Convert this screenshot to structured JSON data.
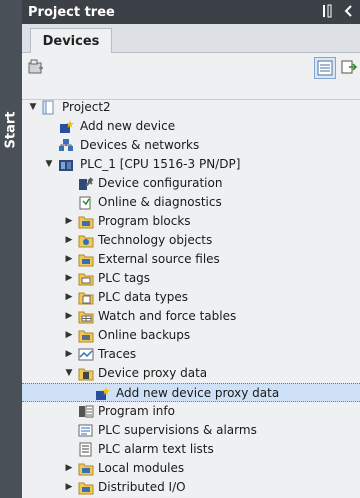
{
  "sidebar": {
    "start_label": "Start"
  },
  "panel": {
    "title": "Project tree",
    "tab": "Devices"
  },
  "tree": [
    {
      "label": "Project2",
      "level": 0,
      "arrow": "down",
      "icon": "project-icon"
    },
    {
      "label": "Add new device",
      "level": 1,
      "arrow": "none",
      "icon": "add-device-icon"
    },
    {
      "label": "Devices & networks",
      "level": 1,
      "arrow": "none",
      "icon": "network-icon"
    },
    {
      "label": "PLC_1 [CPU 1516-3 PN/DP]",
      "level": 1,
      "arrow": "down",
      "icon": "plc-icon"
    },
    {
      "label": "Device configuration",
      "level": 2,
      "arrow": "none",
      "icon": "device-config-icon"
    },
    {
      "label": "Online & diagnostics",
      "level": 2,
      "arrow": "none",
      "icon": "diagnostics-icon"
    },
    {
      "label": "Program blocks",
      "level": 2,
      "arrow": "right",
      "icon": "folder-icon"
    },
    {
      "label": "Technology objects",
      "level": 2,
      "arrow": "right",
      "icon": "technology-icon"
    },
    {
      "label": "External source files",
      "level": 2,
      "arrow": "right",
      "icon": "folder-icon"
    },
    {
      "label": "PLC tags",
      "level": 2,
      "arrow": "right",
      "icon": "tags-icon"
    },
    {
      "label": "PLC data types",
      "level": 2,
      "arrow": "right",
      "icon": "datatypes-icon"
    },
    {
      "label": "Watch and force tables",
      "level": 2,
      "arrow": "right",
      "icon": "watch-table-icon"
    },
    {
      "label": "Online backups",
      "level": 2,
      "arrow": "right",
      "icon": "backup-icon"
    },
    {
      "label": "Traces",
      "level": 2,
      "arrow": "right",
      "icon": "traces-icon"
    },
    {
      "label": "Device proxy data",
      "level": 2,
      "arrow": "down",
      "icon": "proxy-folder-icon"
    },
    {
      "label": "Add new device proxy data",
      "level": 3,
      "arrow": "none",
      "icon": "add-proxy-icon",
      "selected": true
    },
    {
      "label": "Program info",
      "level": 2,
      "arrow": "none",
      "icon": "program-info-icon"
    },
    {
      "label": "PLC supervisions & alarms",
      "level": 2,
      "arrow": "none",
      "icon": "alarms-icon"
    },
    {
      "label": "PLC alarm text lists",
      "level": 2,
      "arrow": "none",
      "icon": "text-list-icon"
    },
    {
      "label": "Local modules",
      "level": 2,
      "arrow": "right",
      "icon": "folder-icon"
    },
    {
      "label": "Distributed I/O",
      "level": 2,
      "arrow": "right",
      "icon": "folder-icon"
    }
  ]
}
